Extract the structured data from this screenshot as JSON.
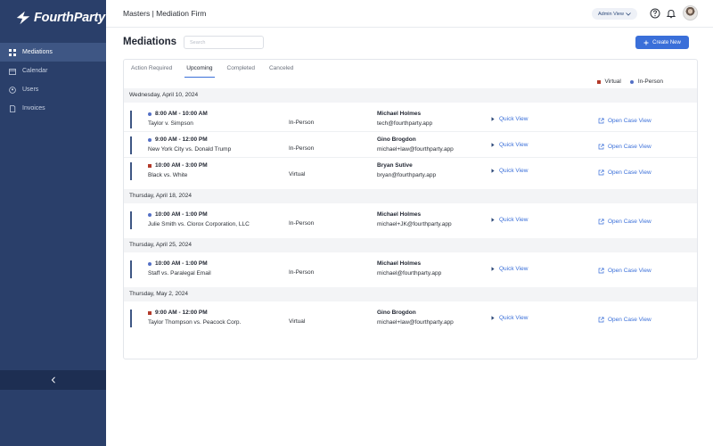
{
  "brand": {
    "name": "FourthParty"
  },
  "sidebar": {
    "items": [
      {
        "label": "Mediations",
        "icon": "grid-icon",
        "active": true
      },
      {
        "label": "Calendar",
        "icon": "calendar-icon",
        "active": false
      },
      {
        "label": "Users",
        "icon": "users-icon",
        "active": false
      },
      {
        "label": "Invoices",
        "icon": "invoice-icon",
        "active": false
      }
    ]
  },
  "header": {
    "firm_title": "Masters | Mediation Firm",
    "admin_view_label": "Admin View"
  },
  "page": {
    "title": "Mediations",
    "search_placeholder": "Search",
    "create_label": "Create New"
  },
  "tabs": [
    {
      "label": "Action Required",
      "active": false
    },
    {
      "label": "Upcoming",
      "active": true
    },
    {
      "label": "Completed",
      "active": false
    },
    {
      "label": "Canceled",
      "active": false
    }
  ],
  "legend": {
    "virtual": "Virtual",
    "in_person": "In-Person"
  },
  "colors": {
    "virtual": "#b33a2a",
    "in_person": "#5470c6",
    "accent": "#3a6fd9",
    "sidebar": "#2a3f6a"
  },
  "groups": [
    {
      "date": "Wednesday, April 10, 2024",
      "entries": [
        {
          "time": "8:00 AM - 10:00 AM",
          "case": "Taylor v. Simpson",
          "mode": "In-Person",
          "person": "Michael Holmes",
          "email": "tech@fourthparty.app",
          "quick_view": "Quick View",
          "open_case": "Open Case View"
        },
        {
          "time": "9:00 AM - 12:00 PM",
          "case": "New York City vs. Donald Trump",
          "mode": "In-Person",
          "person": "Gino Brogdon",
          "email": "michael+law@fourthparty.app",
          "quick_view": "Quick View",
          "open_case": "Open Case View"
        },
        {
          "time": "10:00 AM - 3:00 PM",
          "case": "Black vs. White",
          "mode": "Virtual",
          "person": "Bryan Sutive",
          "email": "bryan@fourthparty.app",
          "quick_view": "Quick View",
          "open_case": "Open Case View"
        }
      ]
    },
    {
      "date": "Thursday, April 18, 2024",
      "entries": [
        {
          "time": "10:00 AM - 1:00 PM",
          "case": "Julie Smith vs. Clorox Corporation, LLC",
          "mode": "In-Person",
          "person": "Michael Holmes",
          "email": "michael+JK@fourthparty.app",
          "quick_view": "Quick View",
          "open_case": "Open Case View"
        }
      ]
    },
    {
      "date": "Thursday, April 25, 2024",
      "entries": [
        {
          "time": "10:00 AM - 1:00 PM",
          "case": "Staff vs. Paralegal Email",
          "mode": "In-Person",
          "person": "Michael Holmes",
          "email": "michael@fourthparty.app",
          "quick_view": "Quick View",
          "open_case": "Open Case View"
        }
      ]
    },
    {
      "date": "Thursday, May 2, 2024",
      "entries": [
        {
          "time": "9:00 AM - 12:00 PM",
          "case": "Taylor Thompson vs. Peacock Corp.",
          "mode": "Virtual",
          "person": "Gino Brogdon",
          "email": "michael+law@fourthparty.app",
          "quick_view": "Quick View",
          "open_case": "Open Case View"
        }
      ]
    }
  ]
}
